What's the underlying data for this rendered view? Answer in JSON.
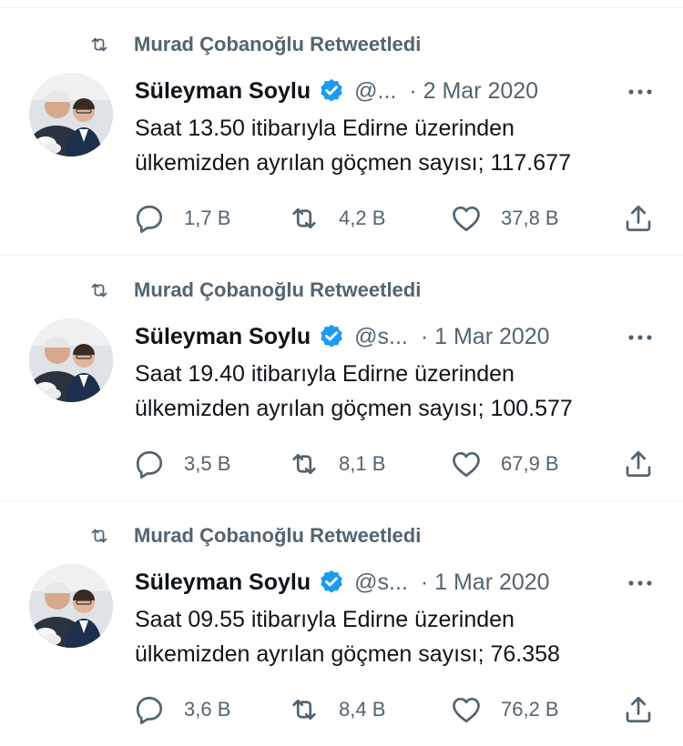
{
  "colors": {
    "secondary_text": "#536471",
    "primary_text": "#0f1419",
    "verified_blue": "#1d9bf0"
  },
  "icons": {
    "retweet": "retweet-icon",
    "verified": "verified-badge-icon",
    "more": "more-options-icon",
    "reply": "reply-icon",
    "share": "share-icon",
    "like": "heart-icon"
  },
  "tweets": [
    {
      "retweeted_by": "Murad Çobanoğlu Retweetledi",
      "author_name": "Süleyman Soylu",
      "handle": "@...",
      "date": "· 2 Mar 2020",
      "text_line1": "Saat 13.50 itibarıyla Edirne üzerinden",
      "text_line2": "ülkemizden ayrılan göçmen sayısı; 117.677",
      "replies": "1,7 B",
      "retweets": "4,2 B",
      "likes": "37,8 B"
    },
    {
      "retweeted_by": "Murad Çobanoğlu Retweetledi",
      "author_name": "Süleyman Soylu",
      "handle": "@s...",
      "date": "· 1 Mar 2020",
      "text_line1": "Saat 19.40 itibarıyla Edirne üzerinden",
      "text_line2": "ülkemizden ayrılan göçmen sayısı; 100.577",
      "replies": "3,5 B",
      "retweets": "8,1 B",
      "likes": "67,9 B"
    },
    {
      "retweeted_by": "Murad Çobanoğlu Retweetledi",
      "author_name": "Süleyman Soylu",
      "handle": "@s...",
      "date": "· 1 Mar 2020",
      "text_line1": "Saat 09.55 itibarıyla Edirne üzerinden",
      "text_line2": "ülkemizden ayrılan göçmen sayısı; 76.358",
      "replies": "3,6 B",
      "retweets": "8,4 B",
      "likes": "76,2 B"
    }
  ]
}
